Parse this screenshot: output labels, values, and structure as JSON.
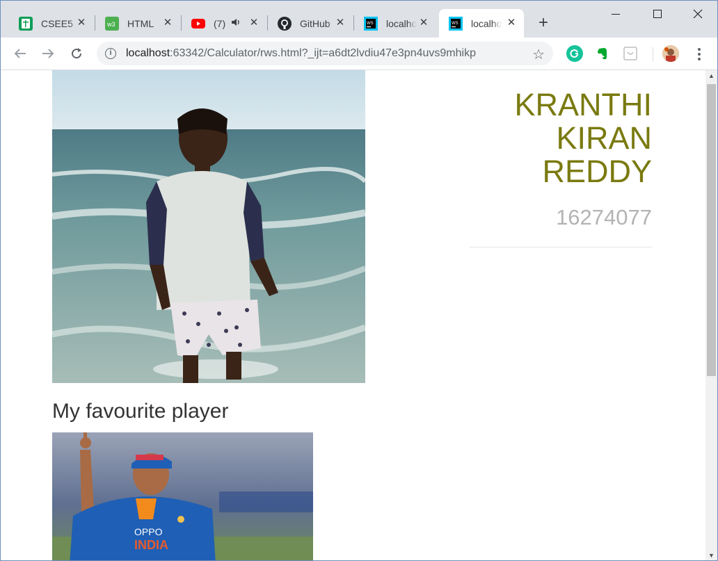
{
  "browser": {
    "tabs": [
      {
        "title": "CSEE5",
        "icon": "sheets-icon",
        "color": "#0f9d58"
      },
      {
        "title": "HTML",
        "icon": "w3schools-icon",
        "color": "#4caf50"
      },
      {
        "title": "(7)",
        "icon": "youtube-icon",
        "color": "#ff0000"
      },
      {
        "title": "GitHub",
        "icon": "github-icon",
        "color": "#24292e"
      },
      {
        "title": "localho",
        "icon": "webstorm-icon",
        "color": "#07c3f2"
      },
      {
        "title": "localho",
        "icon": "webstorm-icon",
        "color": "#07c3f2",
        "active": true
      }
    ],
    "new_tab_label": "+",
    "url_host": "localhost",
    "url_rest": ":63342/Calculator/rws.html?_ijt=a6dt2lvdiu47e3pn4uvs9mhikp"
  },
  "page": {
    "name": "KRANTHI KIRAN REDDY",
    "id_number": "16274077",
    "favourite_heading": "My favourite player",
    "player_jersey_brand": "OPPO",
    "player_jersey_team": "INDIA"
  },
  "colors": {
    "name": "#7a7a10",
    "id_number": "#b3b3b3",
    "heading": "#333333"
  }
}
